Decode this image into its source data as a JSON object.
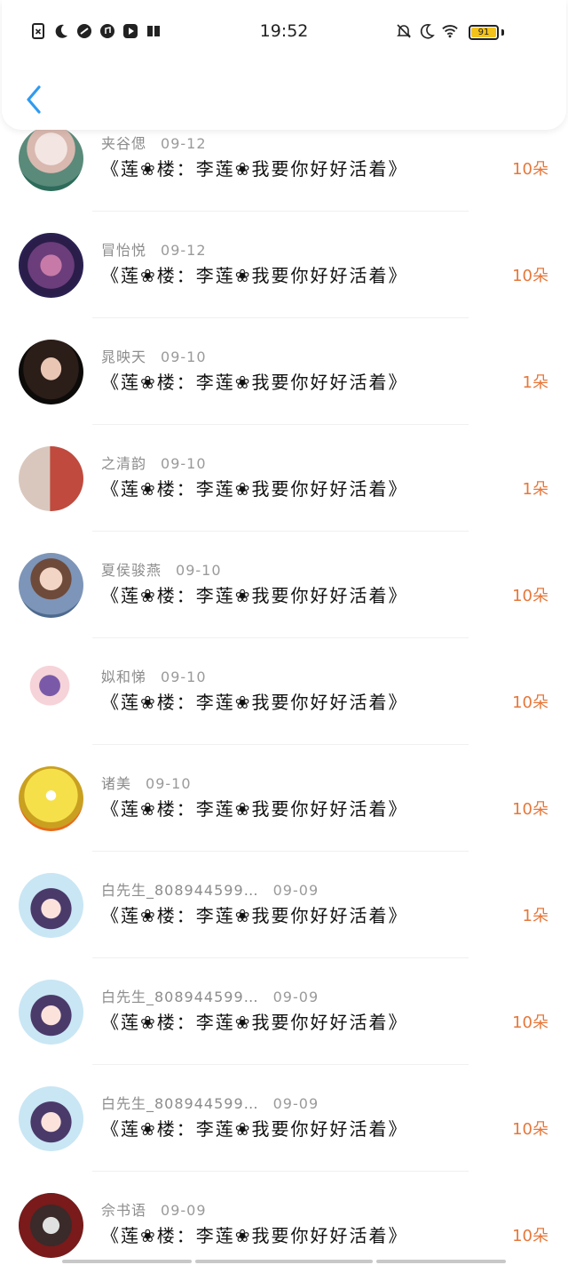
{
  "status_bar": {
    "time": "19:52",
    "battery": "91",
    "left_icons": [
      "doc-x-icon",
      "moon-icon",
      "link-icon",
      "music-icon",
      "play-icon",
      "book-icon"
    ],
    "right_icons": [
      "bell-off-icon",
      "moon-icon",
      "wifi-icon"
    ]
  },
  "nav": {
    "back_icon": "chevron-left-icon",
    "accent": "#2f9bf0"
  },
  "gift_text": "《莲❀楼：李莲❀我要你好好活着》",
  "colors": {
    "count": "#e6773a",
    "name": "#8c8c8c"
  },
  "entries": [
    {
      "name": "夹谷偲",
      "date": "09-12",
      "count": "10朵"
    },
    {
      "name": "冒怡悦",
      "date": "09-12",
      "count": "10朵"
    },
    {
      "name": "晁映天",
      "date": "09-10",
      "count": "1朵"
    },
    {
      "name": "之清韵",
      "date": "09-10",
      "count": "1朵"
    },
    {
      "name": "夏侯骏燕",
      "date": "09-10",
      "count": "10朵"
    },
    {
      "name": "姒和悌",
      "date": "09-10",
      "count": "10朵"
    },
    {
      "name": "诸美",
      "date": "09-10",
      "count": "10朵"
    },
    {
      "name": "白先生_808944599…",
      "date": "09-09",
      "count": "1朵"
    },
    {
      "name": "白先生_808944599…",
      "date": "09-09",
      "count": "10朵"
    },
    {
      "name": "白先生_808944599…",
      "date": "09-09",
      "count": "10朵"
    },
    {
      "name": "佘书语",
      "date": "09-09",
      "count": "10朵"
    }
  ]
}
